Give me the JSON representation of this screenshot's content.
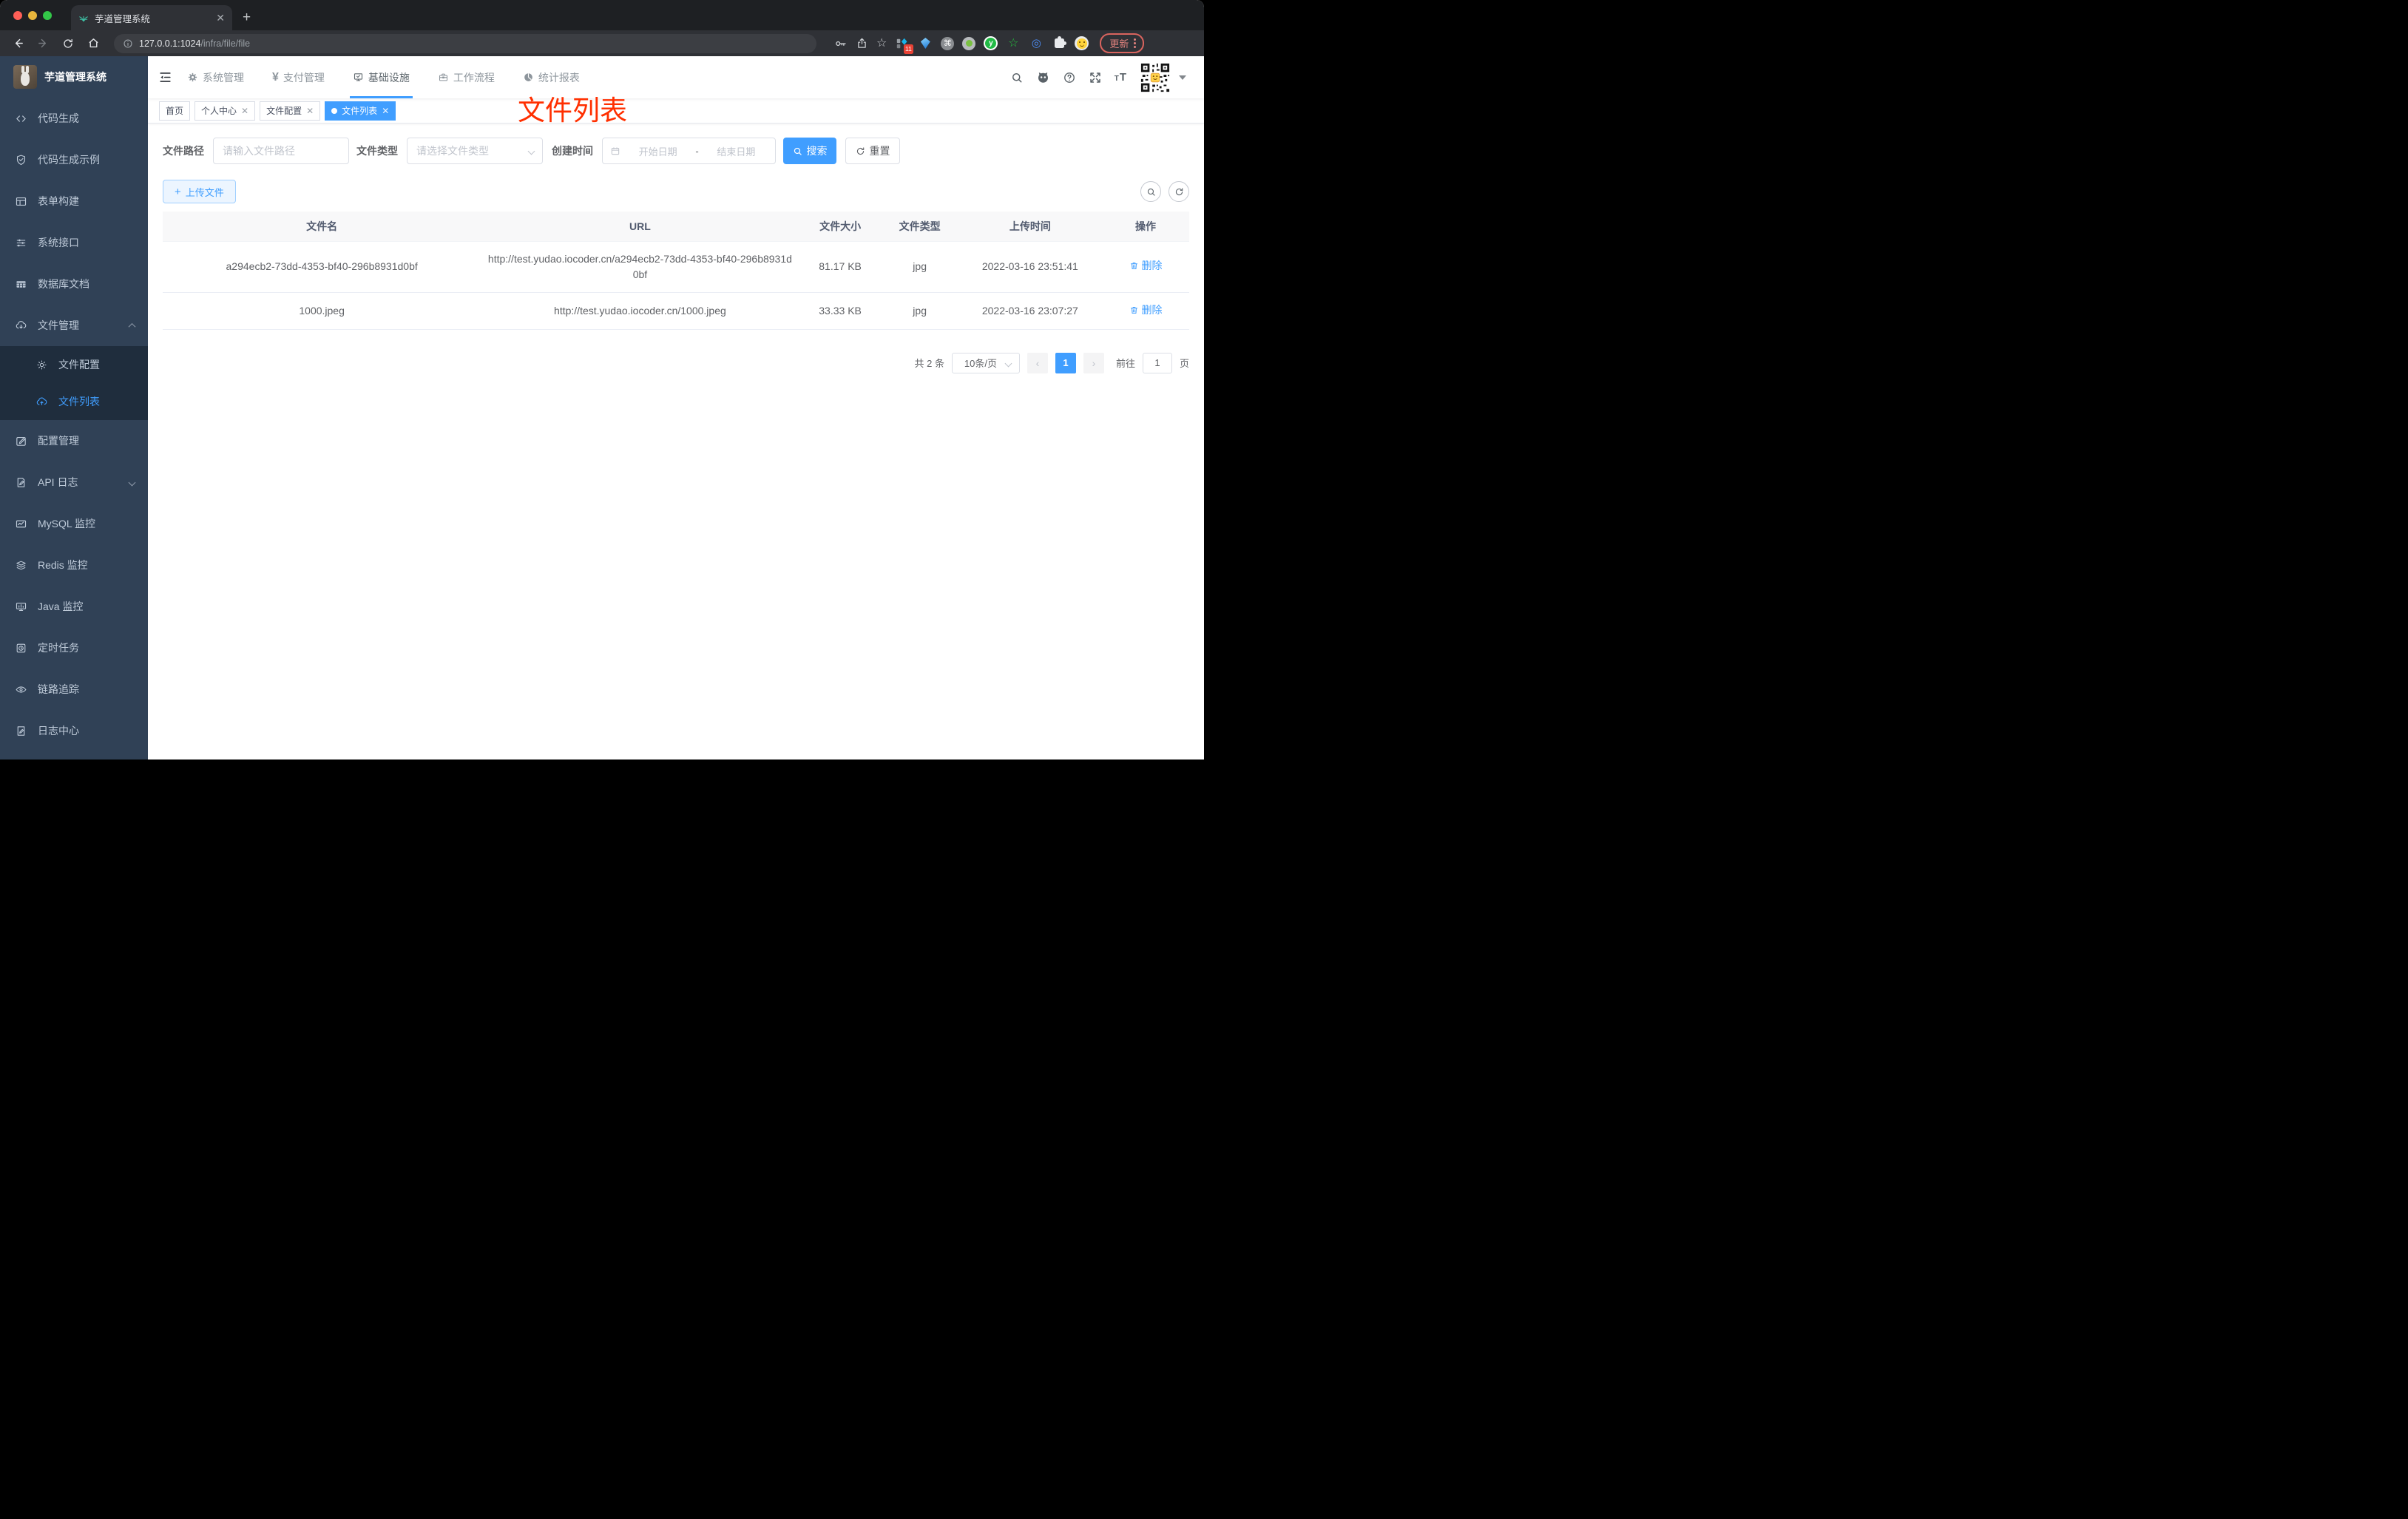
{
  "browser": {
    "tab_title": "芋道管理系统",
    "url_host": "127.0.0.1:1024",
    "url_path": "/infra/file/file",
    "extensions_badge": "11",
    "update_label": "更新"
  },
  "sidebar": {
    "logo_title": "芋道管理系统",
    "items": [
      {
        "label": "代码生成"
      },
      {
        "label": "代码生成示例"
      },
      {
        "label": "表单构建"
      },
      {
        "label": "系统接口"
      },
      {
        "label": "数据库文档"
      },
      {
        "label": "文件管理"
      },
      {
        "label": "配置管理"
      },
      {
        "label": "API 日志"
      },
      {
        "label": "MySQL 监控"
      },
      {
        "label": "Redis 监控"
      },
      {
        "label": "Java 监控"
      },
      {
        "label": "定时任务"
      },
      {
        "label": "链路追踪"
      },
      {
        "label": "日志中心"
      }
    ],
    "submenu": [
      {
        "label": "文件配置"
      },
      {
        "label": "文件列表"
      }
    ]
  },
  "topnav": {
    "items": [
      {
        "label": "系统管理"
      },
      {
        "label": "支付管理"
      },
      {
        "label": "基础设施"
      },
      {
        "label": "工作流程"
      },
      {
        "label": "统计报表"
      }
    ]
  },
  "tags": {
    "items": [
      {
        "label": "首页"
      },
      {
        "label": "个人中心"
      },
      {
        "label": "文件配置"
      },
      {
        "label": "文件列表"
      }
    ]
  },
  "annotation": {
    "text": "文件列表"
  },
  "filters": {
    "path_label": "文件路径",
    "path_placeholder": "请输入文件路径",
    "type_label": "文件类型",
    "type_placeholder": "请选择文件类型",
    "date_label": "创建时间",
    "date_start": "开始日期",
    "date_separator": "-",
    "date_end": "结束日期",
    "search_label": "搜索",
    "reset_label": "重置"
  },
  "toolbar": {
    "upload_label": "上传文件"
  },
  "table": {
    "headers": [
      "文件名",
      "URL",
      "文件大小",
      "文件类型",
      "上传时间",
      "操作"
    ],
    "rows": [
      {
        "name": "a294ecb2-73dd-4353-bf40-296b8931d0bf",
        "url": "http://test.yudao.iocoder.cn/a294ecb2-73dd-4353-bf40-296b8931d0bf",
        "size": "81.17 KB",
        "type": "jpg",
        "time": "2022-03-16 23:51:41",
        "action": "删除"
      },
      {
        "name": "1000.jpeg",
        "url": "http://test.yudao.iocoder.cn/1000.jpeg",
        "size": "33.33 KB",
        "type": "jpg",
        "time": "2022-03-16 23:07:27",
        "action": "删除"
      }
    ]
  },
  "pagination": {
    "total": "共 2 条",
    "page_size": "10条/页",
    "current_page": "1",
    "goto_label": "前往",
    "goto_value": "1",
    "page_unit": "页"
  },
  "colors": {
    "primary": "#409eff",
    "sidebar_bg": "#304156",
    "submenu_bg": "#1f2d3d",
    "annotation": "#ff2f00"
  }
}
